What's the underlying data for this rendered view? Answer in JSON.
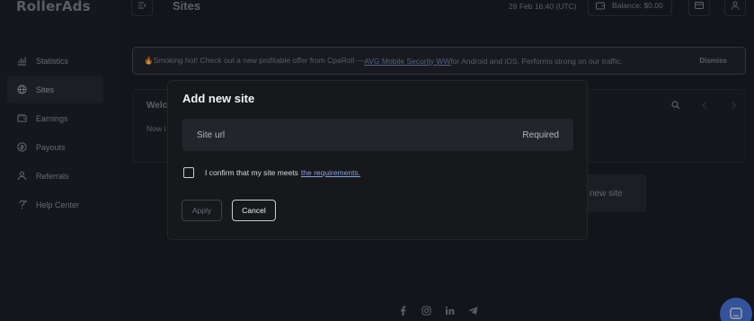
{
  "app": {
    "logo_text": "RollerAds"
  },
  "sidebar": {
    "items": [
      {
        "label": "Statistics",
        "icon": "bar-chart-icon",
        "active": false
      },
      {
        "label": "Sites",
        "icon": "globe-icon",
        "active": true
      },
      {
        "label": "Earnings",
        "icon": "wallet-icon",
        "active": false
      },
      {
        "label": "Payouts",
        "icon": "coin-icon",
        "active": false
      },
      {
        "label": "Referrals",
        "icon": "users-icon",
        "active": false
      },
      {
        "label": "Help Center",
        "icon": "help-icon",
        "active": false
      }
    ]
  },
  "header": {
    "title": "Sites",
    "datetime": "28 Feb 16:40 (UTC)",
    "balance": "Balance: $0.00"
  },
  "banner": {
    "text_before": "🔥Smoking hot! Check out a new profitable offer from CpaRoll — ",
    "link_text": "AVG Mobile Security WW",
    "text_after": " for Android and iOS. Performs strong on our traffic.",
    "dismiss_label": "Dismiss"
  },
  "card": {
    "heading_partial": "Welc",
    "text_partial": "Now i",
    "add_site_label": "new site"
  },
  "modal": {
    "title": "Add new site",
    "url_placeholder": "Site url",
    "url_required": "Required",
    "confirm_text": "I confirm that my site meets",
    "confirm_link": "the requirements.",
    "apply_label": "Apply",
    "cancel_label": "Cancel"
  },
  "footer": {
    "icons": [
      "facebook-icon",
      "instagram-icon",
      "linkedin-icon",
      "telegram-icon"
    ]
  },
  "colors": {
    "background": "#1f2129",
    "modal_bg": "#17181c",
    "accent": "#4f7ff0",
    "link": "#8aa2e0"
  }
}
